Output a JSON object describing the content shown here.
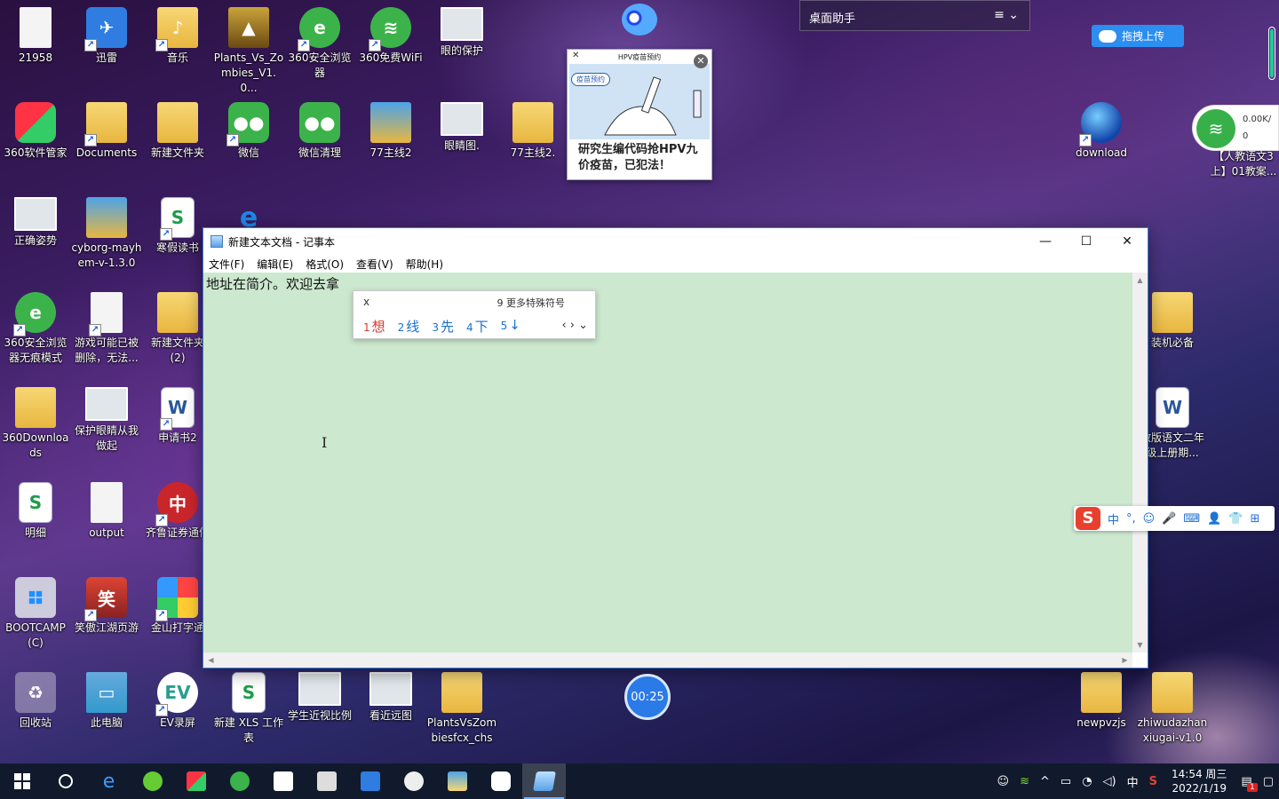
{
  "desktop": {
    "icons": [
      {
        "label": "21958"
      },
      {
        "label": "迅雷"
      },
      {
        "label": "音乐"
      },
      {
        "label": "Plants_Vs_Zombies_V1.0..."
      },
      {
        "label": "360安全浏览器"
      },
      {
        "label": "360免费WiFi"
      },
      {
        "label": "眼的保护"
      },
      {
        "label": "360软件管家"
      },
      {
        "label": "Documents"
      },
      {
        "label": "新建文件夹"
      },
      {
        "label": "微信"
      },
      {
        "label": "微信清理"
      },
      {
        "label": "77主线2"
      },
      {
        "label": "眼睛图."
      },
      {
        "label": "77主线2."
      },
      {
        "label": "download"
      },
      {
        "label": "正确姿势"
      },
      {
        "label": "cyborg-mayhem-v-1.3.0"
      },
      {
        "label": "寒假读书"
      },
      {
        "label": "360安全浏览器无痕模式"
      },
      {
        "label": "游戏可能已被删除，无法..."
      },
      {
        "label": "新建文件夹 (2)"
      },
      {
        "label": "装机必备"
      },
      {
        "label": "360Downloads"
      },
      {
        "label": "保护眼睛从我做起"
      },
      {
        "label": "申请书2"
      },
      {
        "label": "教版语文二年级上册期..."
      },
      {
        "label": "明细"
      },
      {
        "label": "output"
      },
      {
        "label": "齐鲁证券通信"
      },
      {
        "label": "BOOTCAMP (C)"
      },
      {
        "label": "笑傲江湖页游"
      },
      {
        "label": "金山打字通"
      },
      {
        "label": "回收站"
      },
      {
        "label": "此电脑"
      },
      {
        "label": "EV录屏"
      },
      {
        "label": "新建 XLS 工作表"
      },
      {
        "label": "学生近视比例"
      },
      {
        "label": "看近远图"
      },
      {
        "label": "PlantsVsZombiesfcx_chs"
      },
      {
        "label": "newpvzjs"
      },
      {
        "label": "zhiwudazhanxiugai-v1.0"
      },
      {
        "label": "【人教语文3上】01教案..."
      }
    ],
    "helper_title": "桌面助手",
    "helper_menu": "≡ ⌄",
    "upload_label": "拖拽上传",
    "net_speed_up": "0.00K/",
    "net_speed_down": "0"
  },
  "ad": {
    "header": "HPV疫苗预约",
    "tag": "疫苗预约",
    "headline": "研究生编代码抢HPV九价疫苗，已犯法！",
    "close_left": "✕",
    "close_right": "✕"
  },
  "notepad": {
    "title": "新建文本文档 - 记事本",
    "menu": [
      "文件(F)",
      "编辑(E)",
      "格式(O)",
      "查看(V)",
      "帮助(H)"
    ],
    "content": "地址在简介。欢迎去拿",
    "minimize": "—",
    "maximize": "☐",
    "close": "✕"
  },
  "ime": {
    "composition": "x",
    "more_symbols": "9 更多特殊符号",
    "candidates": [
      {
        "num": "1",
        "text": "想"
      },
      {
        "num": "2",
        "text": "线"
      },
      {
        "num": "3",
        "text": "先"
      },
      {
        "num": "4",
        "text": "下"
      },
      {
        "num": "5",
        "text": "↓"
      }
    ],
    "nav": "‹ › ⌄"
  },
  "sogou_toolbar": {
    "logo": "S",
    "items": [
      "中",
      "°,",
      "☺",
      "🎤",
      "⌨",
      "👤",
      "👕",
      "⊞"
    ]
  },
  "timer": "00:25",
  "taskbar": {
    "clock_time": "14:54 周三",
    "clock_date": "2022/1/19",
    "ime_indicator": "中",
    "notification_count": "1"
  },
  "colors": {
    "notepad_bg": "#cce8cf",
    "taskbar_bg": "#101a2c",
    "accent": "#2a7ae8"
  }
}
